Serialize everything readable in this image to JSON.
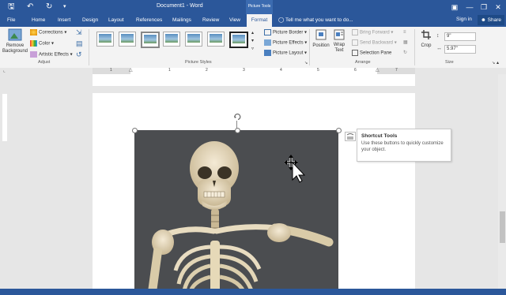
{
  "titlebar": {
    "doc_title": "Document1 - Word",
    "context_tab": "Picture Tools",
    "qa_save_icon": "save-icon",
    "qa_undo_icon": "undo-icon",
    "qa_redo_icon": "redo-icon"
  },
  "tabs": [
    "File",
    "Home",
    "Insert",
    "Design",
    "Layout",
    "References",
    "Mailings",
    "Review",
    "View"
  ],
  "active_tab": "Format",
  "tell_me": "Tell me what you want to do...",
  "account": {
    "sign_in": "Sign in",
    "share": "Share"
  },
  "ribbon": {
    "adjust": {
      "label": "Adjust",
      "remove_background": "Remove Background",
      "corrections": "Corrections",
      "color": "Color",
      "artistic_effects": "Artistic Effects"
    },
    "picture_styles": {
      "label": "Picture Styles",
      "picture_border": "Picture Border",
      "picture_effects": "Picture Effects",
      "picture_layout": "Picture Layout"
    },
    "arrange": {
      "label": "Arrange",
      "position": "Position",
      "wrap_text": "Wrap Text",
      "bring_forward": "Bring Forward",
      "send_backward": "Send Backward",
      "selection_pane": "Selection Pane"
    },
    "size": {
      "label": "Size",
      "crop": "Crop",
      "height": "9\"",
      "width": "5.97\""
    }
  },
  "ruler": {
    "numbers": [
      "1",
      "1",
      "2",
      "3",
      "4",
      "5",
      "6",
      "7"
    ]
  },
  "tooltip": {
    "title": "Shortcut Tools",
    "body": "Use these buttons to quickly customize your object."
  },
  "colors": {
    "accent": "#2b579a",
    "ribbon_bg": "#f3f3f3",
    "canvas_bg": "#e6e6e6",
    "photo_bg": "#4b4d50"
  }
}
